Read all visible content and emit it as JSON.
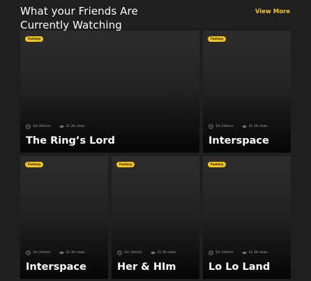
{
  "header": {
    "title": "What your Friends Are Currently Watching",
    "view_more": "View More"
  },
  "colors": {
    "background": "#1f1f1f",
    "accent": "#f5c518",
    "text": "#ffffff",
    "muted": "#a7a7a7"
  },
  "cards": [
    {
      "title": "The Ring’s Lord",
      "genre": "Fantasy",
      "duration": "1hr 24mins",
      "views": "21.3K views"
    },
    {
      "title": "Interspace",
      "genre": "Fantasy",
      "duration": "1hr 24mins",
      "views": "21.3K views"
    },
    {
      "title": "Interspace",
      "genre": "Fantasy",
      "duration": "1hr 24mins",
      "views": "21.3K views"
    },
    {
      "title": "Her & HIm",
      "genre": "Fantasy",
      "duration": "1hr 24mins",
      "views": "21.3K views"
    },
    {
      "title": "Lo Lo Land",
      "genre": "Fantasy",
      "duration": "1hr 24mins",
      "views": "21.3K views"
    }
  ],
  "icons": {
    "duration": "clock-icon",
    "views": "eye-icon"
  }
}
